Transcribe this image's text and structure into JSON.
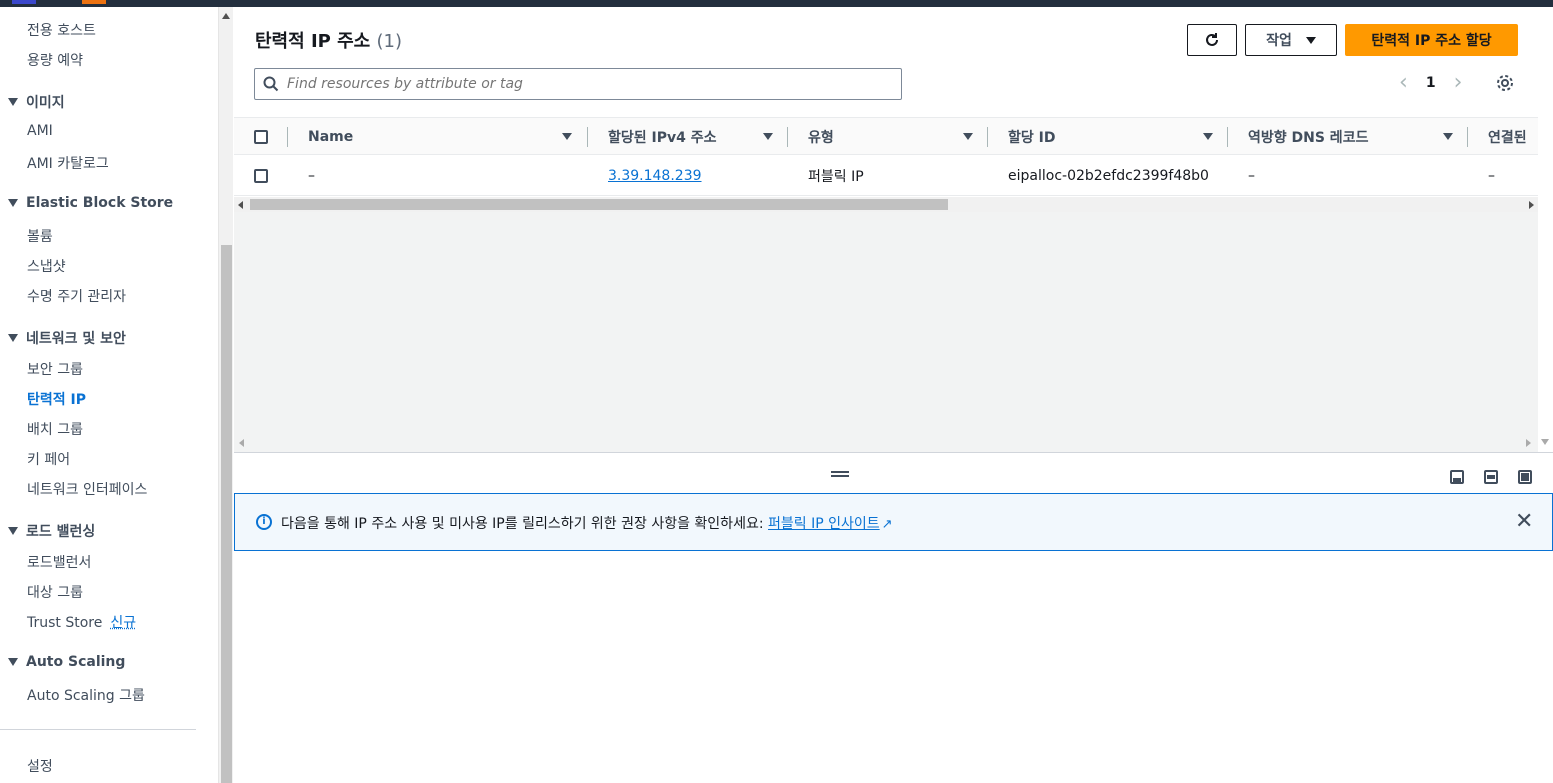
{
  "sidebar": {
    "items": [
      {
        "label": "전용 호스트"
      },
      {
        "label": "용량 예약"
      }
    ],
    "images": {
      "heading": "이미지",
      "items": [
        "AMI",
        "AMI 카탈로그"
      ]
    },
    "ebs": {
      "heading": "Elastic Block Store",
      "items": [
        "볼륨",
        "스냅샷",
        "수명 주기 관리자"
      ]
    },
    "network": {
      "heading": "네트워크 및 보안",
      "items": [
        "보안 그룹",
        "탄력적 IP",
        "배치 그룹",
        "키 페어",
        "네트워크 인터페이스"
      ]
    },
    "lb": {
      "heading": "로드 밸런싱",
      "items": [
        "로드밸런서",
        "대상 그룹",
        "Trust Store"
      ],
      "new_badge": "신규"
    },
    "asg": {
      "heading": "Auto Scaling",
      "items": [
        "Auto Scaling 그룹"
      ]
    },
    "settings": "설정"
  },
  "header": {
    "title": "탄력적 IP 주소",
    "count": "(1)",
    "actions_label": "작업",
    "primary_label": "탄력적 IP 주소 할당"
  },
  "search": {
    "placeholder": "Find resources by attribute or tag"
  },
  "pagination": {
    "current_page": "1",
    "prev": "‹",
    "next": "›"
  },
  "table": {
    "columns": [
      "Name",
      "할당된 IPv4 주소",
      "유형",
      "할당 ID",
      "역방향 DNS 레코드",
      "연결된"
    ],
    "rows": [
      {
        "name": "–",
        "ipv4": "3.39.148.239",
        "type": "퍼블릭 IP",
        "allocation_id": "eipalloc-02b2efdc2399f48b0",
        "reverse_dns": "–",
        "associated": "–"
      }
    ]
  },
  "flash": {
    "message": "다음을 통해 IP 주소 사용 및 미사용 IP를 릴리스하기 위한 권장 사항을 확인하세요: ",
    "link": "퍼블릭 IP 인사이트"
  },
  "colors": {
    "accent": "#0972d3",
    "primary_button": "#ff9900",
    "topbar": "#232f3e"
  }
}
